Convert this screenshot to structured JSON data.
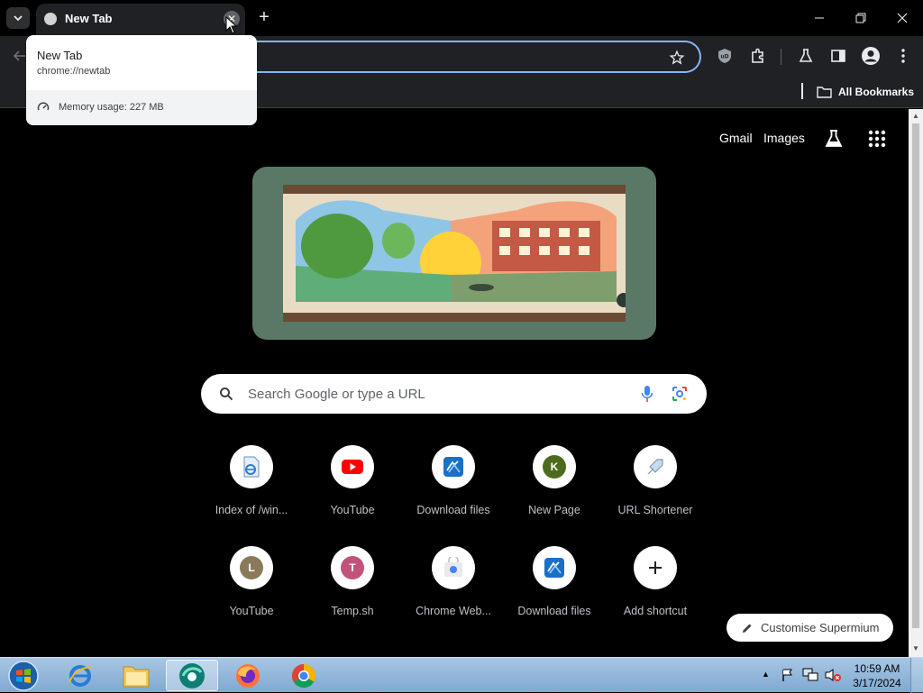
{
  "tab": {
    "title": "New Tab",
    "close_glyph": "✕"
  },
  "tabstrip": {
    "search_glyph": "⌄",
    "new_tab_glyph": "+"
  },
  "window": {
    "minimize": "—",
    "restore": "❐",
    "close": "✕"
  },
  "hovercard": {
    "title": "New Tab",
    "url": "chrome://newtab",
    "memory": "Memory usage: 227 MB"
  },
  "bookmarks": {
    "all_label": "All Bookmarks"
  },
  "page": {
    "top_links": {
      "gmail": "Gmail",
      "images": "Images"
    },
    "search_placeholder": "Search Google or type a URL",
    "shortcuts": [
      {
        "label": "Index of /win...",
        "icon": "ie-document-icon"
      },
      {
        "label": "YouTube",
        "icon": "youtube-icon"
      },
      {
        "label": "Download files",
        "icon": "download-files-icon"
      },
      {
        "label": "New Page",
        "icon": "letter-k",
        "letter": "K",
        "color": "#4d6b1e"
      },
      {
        "label": "URL Shortener",
        "icon": "url-shortener-icon"
      },
      {
        "label": "YouTube",
        "icon": "letter-l",
        "letter": "L",
        "color": "#8a7a5a"
      },
      {
        "label": "Temp.sh",
        "icon": "letter-t",
        "letter": "T",
        "color": "#c2527a"
      },
      {
        "label": "Chrome Web...",
        "icon": "chrome-web-store-icon"
      },
      {
        "label": "Download files",
        "icon": "download-files-icon"
      },
      {
        "label": "Add shortcut",
        "icon": "plus-icon"
      }
    ],
    "customise_label": "Customise Supermium"
  },
  "taskbar": {
    "clock_time": "10:59 AM",
    "clock_date": "3/17/2024"
  },
  "colors": {
    "accent": "#8ab4f8",
    "doodle_frame": "#5a7866",
    "youtube_red": "#ff0000"
  }
}
